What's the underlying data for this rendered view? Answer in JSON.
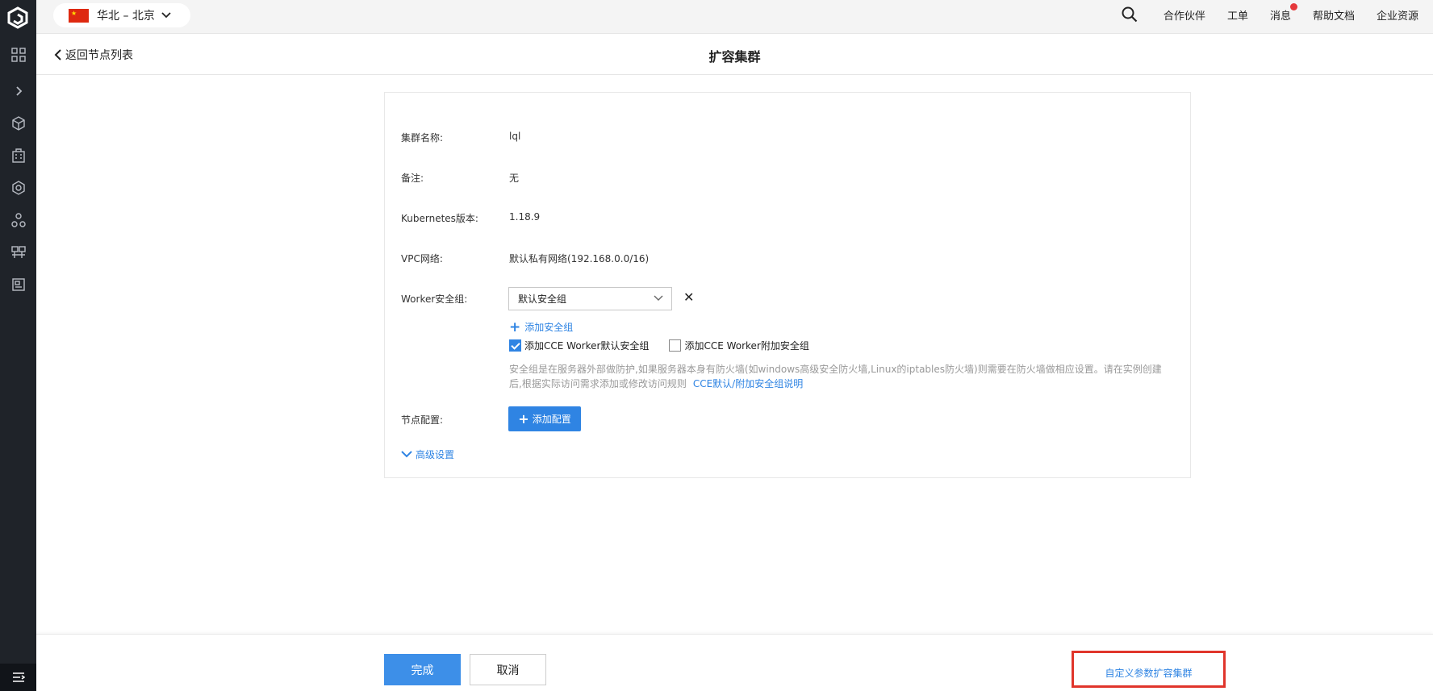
{
  "topbar": {
    "region": "华北 – 北京",
    "nav": [
      "合作伙伴",
      "工单",
      "消息",
      "帮助文档",
      "企业资源"
    ]
  },
  "header": {
    "back_label": "返回节点列表",
    "title": "扩容集群"
  },
  "form": {
    "cluster_name_label": "集群名称:",
    "cluster_name_value": "lql",
    "remark_label": "备注:",
    "remark_value": "无",
    "k8s_label": "Kubernetes版本:",
    "k8s_value": "1.18.9",
    "vpc_label": "VPC网络:",
    "vpc_value": "默认私有网络(192.168.0.0/16)",
    "worker_sg_label": "Worker安全组:",
    "worker_sg_selected": "默认安全组",
    "add_sg_label": "添加安全组",
    "cb_default_label": "添加CCE Worker默认安全组",
    "cb_default_checked": true,
    "cb_extra_label": "添加CCE Worker附加安全组",
    "cb_extra_checked": false,
    "help_text": "安全组是在服务器外部做防护,如果服务器本身有防火墙(如windows高级安全防火墙,Linux的iptables防火墙)则需要在防火墙做相应设置。请在实例创建后,根据实际访问需求添加或修改访问规则",
    "help_link": "CCE默认/附加安全组说明",
    "node_config_label": "节点配置:",
    "add_config_label": "添加配置",
    "advanced_label": "高级设置"
  },
  "footer": {
    "done_label": "完成",
    "cancel_label": "取消",
    "custom_label": "自定义参数扩容集群"
  },
  "colors": {
    "accent": "#2f84e3",
    "sidebar": "#1f2329",
    "highlight_border": "#e0352b",
    "notify_dot": "#e5383b"
  }
}
